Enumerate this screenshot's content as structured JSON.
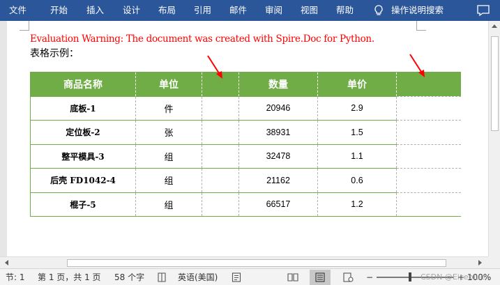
{
  "ribbon": {
    "tabs": [
      "文件",
      "开始",
      "插入",
      "设计",
      "布局",
      "引用",
      "邮件",
      "审阅",
      "视图",
      "帮助"
    ],
    "tell_me": "操作说明搜索",
    "bulb_icon": "lightbulb-icon",
    "comment_icon": "comment-icon",
    "accent": "#2b579a"
  },
  "document": {
    "warning": "Evaluation Warning: The document was created with Spire.Doc for Python.",
    "caption": "表格示例：",
    "warning_color": "#ff0000"
  },
  "table": {
    "header_color": "#70ad47",
    "headers": [
      "商品名称",
      "单位",
      "",
      "数量",
      "单价",
      ""
    ],
    "rows": [
      {
        "name": "底板-1",
        "unit": "件",
        "qty": "20946",
        "price": "2.9"
      },
      {
        "name": "定位板-2",
        "unit": "张",
        "qty": "38931",
        "price": "1.5"
      },
      {
        "name": "整平模具-3",
        "unit": "组",
        "qty": "32478",
        "price": "1.1"
      },
      {
        "name": "后壳 FD1042-4",
        "unit": "组",
        "qty": "21162",
        "price": "0.6"
      },
      {
        "name": "棍子-5",
        "unit": "组",
        "qty": "66517",
        "price": "1.2"
      }
    ]
  },
  "status": {
    "section": "节: 1",
    "page": "第 1 页，共 1 页",
    "words": "58 个字",
    "language": "英语(美国)",
    "zoom_minus": "−",
    "zoom_plus": "+",
    "zoom": "100%",
    "watermark": "CSDN @Eiceblue"
  }
}
